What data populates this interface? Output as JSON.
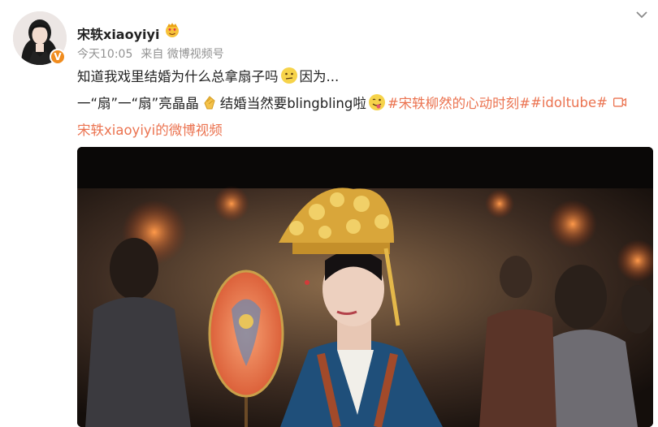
{
  "post": {
    "username": "宋轶xiaoyiyi",
    "time": "今天10:05",
    "source": "来自 微博视频号",
    "line1_a": "知道我戏里结婚为什么总拿扇子吗",
    "line1_b": "因为...",
    "line2_a": "一“扇”一“扇”亮晶晶",
    "line2_b": "结婚当然要blingbling啦",
    "hashtag1": "#宋轶柳然的心动时刻#",
    "hashtag2": "#idoltube#",
    "video_link": "宋轶xiaoyiyi的微博视频",
    "verified_badge": "V"
  },
  "icons": {
    "crown": "crown-heart-eyes-icon",
    "thinking": "thinking-emoji-icon",
    "clap": "clap-emoji-icon",
    "tongue": "tongue-emoji-icon",
    "video": "video-link-icon",
    "menu": "chevron-down-icon"
  },
  "colors": {
    "accent": "#eb7350",
    "verified": "#f08c1e",
    "meta": "#939393"
  }
}
